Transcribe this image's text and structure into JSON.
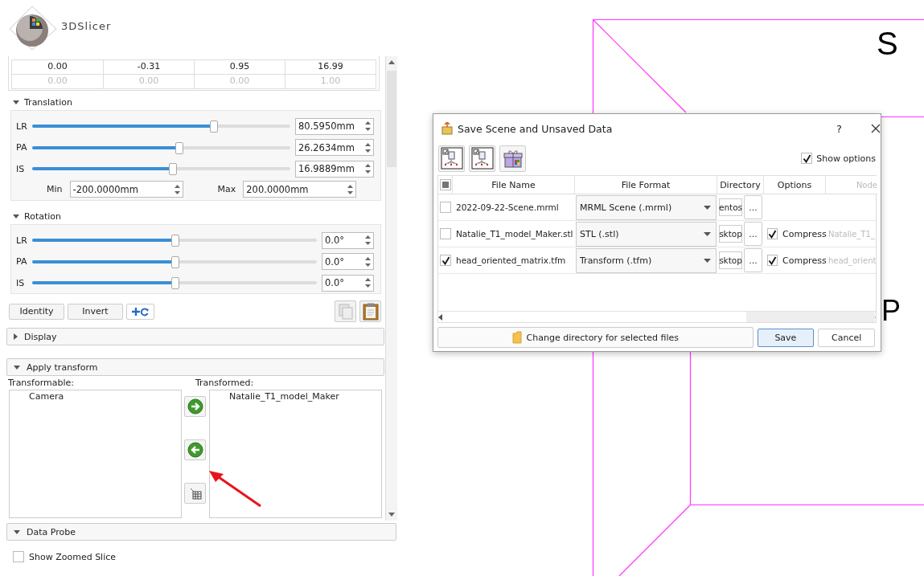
{
  "app": {
    "logo_text": "3DSlicer"
  },
  "matrix": {
    "rows": [
      {
        "cells": [
          "0.00",
          "-0.31",
          "0.95",
          "16.99"
        ],
        "disabled": false
      },
      {
        "cells": [
          "0.00",
          "0.00",
          "0.00",
          "1.00"
        ],
        "disabled": true
      }
    ]
  },
  "translation": {
    "title": "Translation",
    "expanded": true,
    "sliders": [
      {
        "label": "LR",
        "level": 0.7,
        "value": "80.5950mm"
      },
      {
        "label": "PA",
        "level": 0.566,
        "value": "26.2634mm"
      },
      {
        "label": "IS",
        "level": 0.542,
        "value": "16.9889mm"
      }
    ],
    "min_label": "Min",
    "min": "-200.0000mm",
    "max_label": "Max",
    "max": "200.0000mm"
  },
  "rotation": {
    "title": "Rotation",
    "expanded": true,
    "sliders": [
      {
        "label": "LR",
        "level": 0.5,
        "value": "0.0°"
      },
      {
        "label": "PA",
        "level": 0.5,
        "value": "0.0°"
      },
      {
        "label": "IS",
        "level": 0.5,
        "value": "0.0°"
      }
    ]
  },
  "buttons": [
    "Identity",
    "Invert"
  ],
  "display": {
    "title": "Display",
    "expanded": false
  },
  "apply_transform": {
    "title": "Apply transform",
    "expanded": true,
    "transformable_label": "Transformable:",
    "transformable": [
      "Camera"
    ],
    "transformed_label": "Transformed:",
    "transformed": [
      "Natalie_T1_model_Maker"
    ]
  },
  "data_probe": {
    "title": "Data Probe",
    "expanded": true,
    "show_zoomed_slice": {
      "label": "Show Zoomed Slice",
      "checked": false
    }
  },
  "view": {
    "labels": [
      "S",
      "P"
    ]
  },
  "dialog": {
    "title": "Save Scene and Unsaved Data",
    "help": "?",
    "show_options": {
      "label": "Show options",
      "checked": true
    },
    "select_all_partial": true,
    "columns": [
      "File Name",
      "File Format",
      "Directory",
      "Options",
      "Node"
    ],
    "rows": [
      {
        "checked": false,
        "file_name": "2022-09-22-Scene.mrml",
        "format": "MRML Scene (.mrml)",
        "directory": "entos",
        "browse": "..."
      },
      {
        "checked": false,
        "file_name": "Natalie_T1_model_Maker.stl",
        "format": "STL (.stl)",
        "directory": "sktop",
        "browse": "...",
        "compress": {
          "label": "Compress",
          "checked": true
        },
        "node": "Natalie_T1_"
      },
      {
        "checked": true,
        "file_name": "head_oriented_matrix.tfm",
        "format": "Transform (.tfm)",
        "directory": "sktop",
        "browse": "...",
        "compress": {
          "label": "Compress",
          "checked": true
        },
        "node": "head_orient"
      }
    ],
    "change_directory": "Change directory for selected files",
    "save": "Save",
    "cancel": "Cancel"
  }
}
